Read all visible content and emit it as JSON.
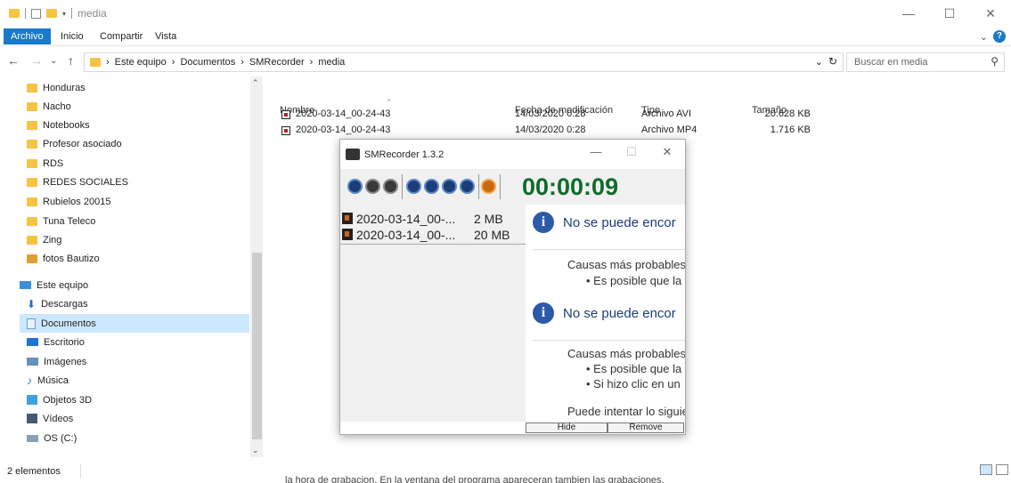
{
  "window": {
    "title": "media"
  },
  "ribbon": {
    "tabs": [
      "Archivo",
      "Inicio",
      "Compartir",
      "Vista"
    ]
  },
  "address": {
    "path": [
      "Este equipo",
      "Documentos",
      "SMRecorder",
      "media"
    ]
  },
  "search": {
    "placeholder": "Buscar en media"
  },
  "nav": {
    "items": [
      {
        "label": "Honduras",
        "icon": "folder-icon"
      },
      {
        "label": "Nacho",
        "icon": "folder-icon"
      },
      {
        "label": "Notebooks",
        "icon": "folder-icon"
      },
      {
        "label": "Profesor asociado",
        "icon": "folder-icon"
      },
      {
        "label": "RDS",
        "icon": "folder-icon"
      },
      {
        "label": "REDES SOCIALES",
        "icon": "folder-icon"
      },
      {
        "label": "Rubielos 20015",
        "icon": "folder-icon"
      },
      {
        "label": "Tuna Teleco",
        "icon": "folder-icon"
      },
      {
        "label": "Zing",
        "icon": "folder-icon"
      },
      {
        "label": "fotos Bautizo",
        "icon": "folder-icon"
      },
      {
        "label": "Este equipo",
        "icon": "computer-icon"
      },
      {
        "label": "Descargas",
        "icon": "download-icon"
      },
      {
        "label": "Documentos",
        "icon": "documents-icon"
      },
      {
        "label": "Escritorio",
        "icon": "desktop-icon"
      },
      {
        "label": "Imágenes",
        "icon": "pictures-icon"
      },
      {
        "label": "Música",
        "icon": "music-icon"
      },
      {
        "label": "Objetos 3D",
        "icon": "objects-3d-icon"
      },
      {
        "label": "Vídeos",
        "icon": "videos-icon"
      },
      {
        "label": "OS (C:)",
        "icon": "drive-icon"
      }
    ]
  },
  "files": {
    "columns": [
      "Nombre",
      "Fecha de modificación",
      "Tipo",
      "Tamaño"
    ],
    "rows": [
      {
        "name": "2020-03-14_00-24-43",
        "date": "14/03/2020 0:28",
        "type": "Archivo AVI",
        "size": "20.628 KB"
      },
      {
        "name": "2020-03-14_00-24-43",
        "date": "14/03/2020 0:28",
        "type": "Archivo MP4",
        "size": "1.716 KB"
      }
    ]
  },
  "status": {
    "count": "2 elementos"
  },
  "bottom_text": "la hora de grabacion. En la ventana del programa apareceran tambien las grabaciones.",
  "smrecorder": {
    "title": "SMRecorder 1.3.2",
    "timer": "00:00:09",
    "recordings": [
      {
        "name": "2020-03-14_00-...",
        "size": "2 MB"
      },
      {
        "name": "2020-03-14_00-...",
        "size": "20 MB"
      }
    ],
    "info": {
      "heading": "No se puede encor",
      "causes": "Causas más probables:",
      "bullet1": "Es posible que la",
      "bullet2": "Si hizo clic en un",
      "try": "Puede intentar lo siguie"
    },
    "buttons": {
      "hide": "Hide",
      "remove": "Remove"
    }
  }
}
